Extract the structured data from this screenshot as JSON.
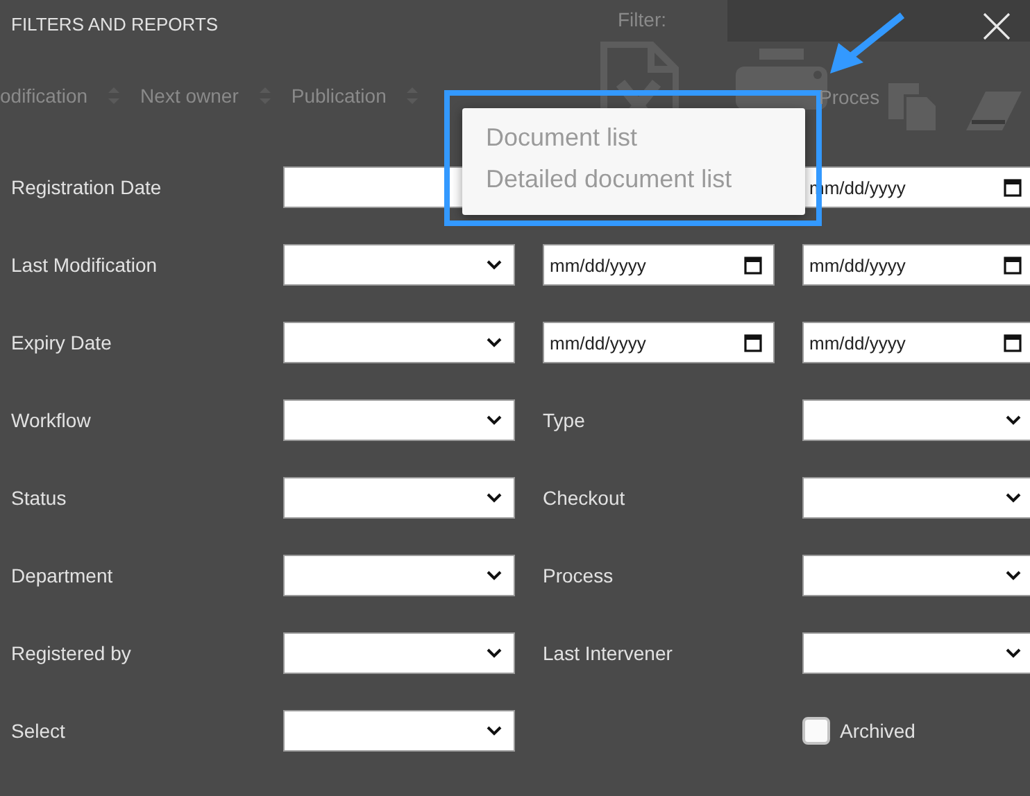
{
  "window": {
    "title": "FILTERS AND REPORTS"
  },
  "background_table": {
    "columns": [
      "odification",
      "Next owner",
      "Publication",
      "Proces"
    ]
  },
  "filter_label": "Filter:",
  "toolbar": [
    {
      "kind": "excel"
    },
    {
      "kind": "printer"
    },
    {
      "kind": "copy"
    },
    {
      "kind": "eraser"
    }
  ],
  "popup_menu": {
    "items": [
      "Document list",
      "Detailed document list"
    ]
  },
  "rows": [
    {
      "label": "Registration Date",
      "cells": [
        {
          "kind": "text"
        },
        {
          "kind": "covered"
        },
        {
          "kind": "date",
          "placeholder": "mm/dd/yyyy"
        }
      ]
    },
    {
      "label": "Last Modification",
      "cells": [
        {
          "kind": "select"
        },
        {
          "kind": "date",
          "placeholder": "mm/dd/yyyy"
        },
        {
          "kind": "date",
          "placeholder": "mm/dd/yyyy"
        }
      ]
    },
    {
      "label": "Expiry Date",
      "cells": [
        {
          "kind": "select"
        },
        {
          "kind": "date",
          "placeholder": "mm/dd/yyyy"
        },
        {
          "kind": "date",
          "placeholder": "mm/dd/yyyy"
        }
      ]
    },
    {
      "label": "Workflow",
      "cells": [
        {
          "kind": "select"
        },
        {
          "kind": "label",
          "text": "Type"
        },
        {
          "kind": "select"
        }
      ]
    },
    {
      "label": "Status",
      "cells": [
        {
          "kind": "select"
        },
        {
          "kind": "label",
          "text": "Checkout"
        },
        {
          "kind": "select"
        }
      ]
    },
    {
      "label": "Department",
      "cells": [
        {
          "kind": "select"
        },
        {
          "kind": "label",
          "text": "Process"
        },
        {
          "kind": "select"
        }
      ]
    },
    {
      "label": "Registered by",
      "cells": [
        {
          "kind": "select"
        },
        {
          "kind": "label",
          "text": "Last Intervener"
        },
        {
          "kind": "select"
        }
      ]
    },
    {
      "label": "Select",
      "cells": [
        {
          "kind": "select"
        },
        {
          "kind": "covered"
        },
        {
          "kind": "checkbox",
          "text": "Archived",
          "checked": false
        }
      ]
    }
  ]
}
